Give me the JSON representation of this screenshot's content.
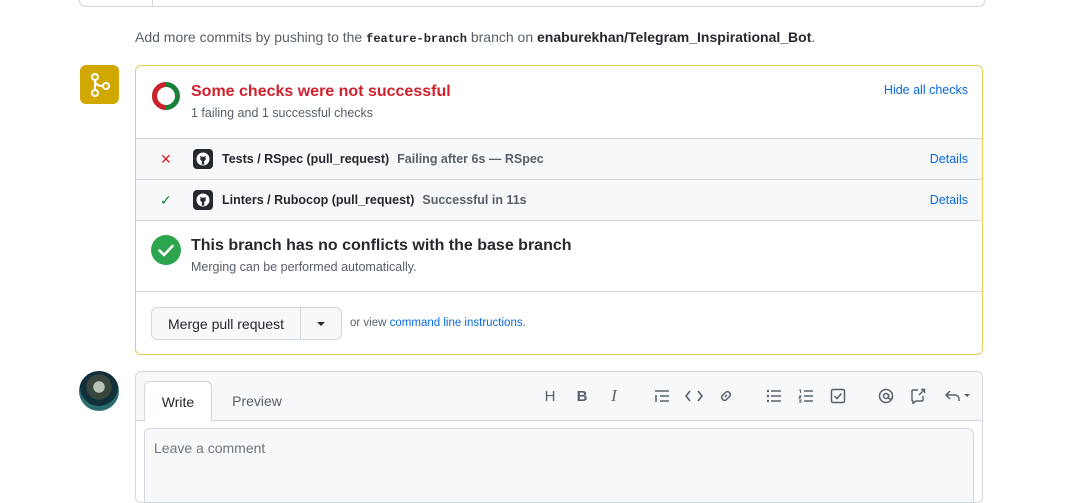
{
  "hint": {
    "prefix": "Add more commits by pushing to the",
    "branch": "feature-branch",
    "middle": "branch on",
    "repo": "enaburekhan/Telegram_Inspirational_Bot",
    "suffix": "."
  },
  "status": {
    "title": "Some checks were not successful",
    "subtitle": "1 failing and 1 successful checks",
    "hide_link": "Hide all checks",
    "failing_fraction": 0.5
  },
  "checks": [
    {
      "state": "failure",
      "name": "Tests / RSpec (pull_request)",
      "description": "Failing after 6s — RSpec",
      "details": "Details"
    },
    {
      "state": "success",
      "name": "Linters / Rubocop (pull_request)",
      "description": "Successful in 11s",
      "details": "Details"
    }
  ],
  "conflicts": {
    "title": "This branch has no conflicts with the base branch",
    "subtitle": "Merging can be performed automatically."
  },
  "merge": {
    "button_label": "Merge pull request",
    "note_prefix": "or view",
    "note_link": "command line instructions",
    "note_suffix": "."
  },
  "comment": {
    "tab_write": "Write",
    "tab_preview": "Preview",
    "placeholder": "Leave a comment",
    "toolbar_icons": [
      "heading-icon",
      "bold-icon",
      "italic-icon",
      "quote-icon",
      "code-icon",
      "link-icon",
      "unordered-list-icon",
      "ordered-list-icon",
      "task-list-icon",
      "mention-icon",
      "cross-reference-icon",
      "reply-icon"
    ]
  },
  "colors": {
    "failure": "#cf222e",
    "success": "#1a7f37",
    "merge_icon_bg": "#d0a800",
    "link": "#0969da"
  }
}
